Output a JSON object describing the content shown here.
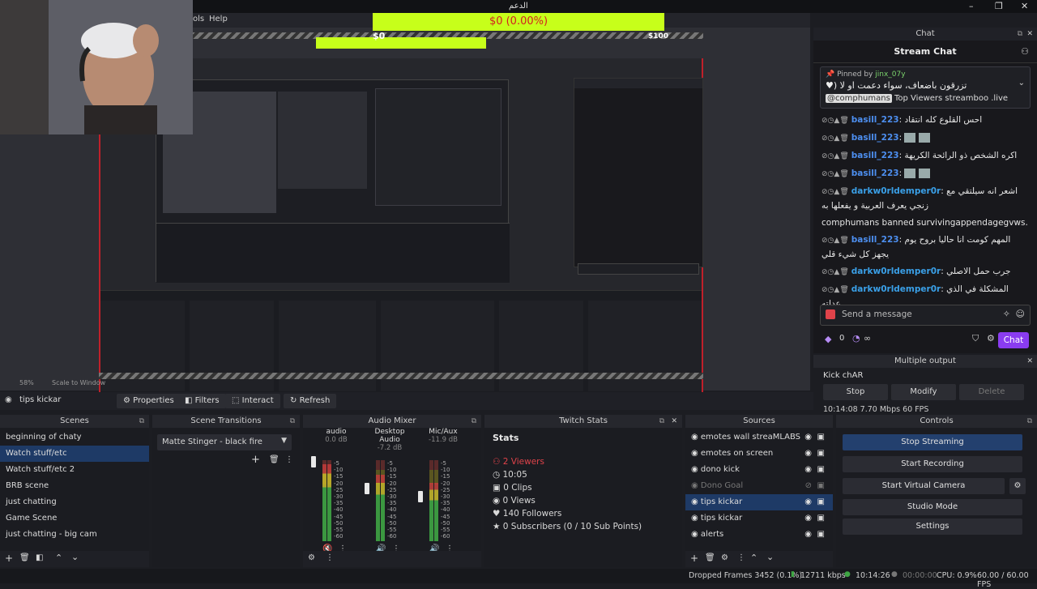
{
  "titlebar": {
    "title": "الدعم"
  },
  "menubar": {
    "items": [
      "ols",
      "Help"
    ]
  },
  "donation": {
    "text": "$0 (0.00%)",
    "inner_text": "$0",
    "inner_right": "$100"
  },
  "preview": {
    "zoom": "58%",
    "scale_label": "Scale to Window"
  },
  "toolbar": {
    "source_name": "tips kickar",
    "properties": "Properties",
    "filters": "Filters",
    "interact": "Interact",
    "refresh": "Refresh"
  },
  "chat": {
    "dock_title": "Chat",
    "header": "Stream Chat",
    "pinned_by": "Pinned by",
    "pinned_user": "jinx_07y",
    "pinned_msg": "تزرقون باضعاف، سواء دعمت او لا (♥",
    "pinned_mention": "@comphumans",
    "pinned_rest": "Top Viewers streamboo .live",
    "messages": [
      {
        "user": "basill_223",
        "text": "احس القلوع كله انتقاد"
      },
      {
        "user": "basill_223",
        "text": ""
      },
      {
        "user": "basill_223",
        "text": "اكره الشخص ذو الرائحة الكريهة"
      },
      {
        "user": "basill_223",
        "text": ""
      },
      {
        "user": "darkw0rldemper0r",
        "text": "اشعر انه سيلتقي مع زنجي يعرف العربية و يفعلها به"
      },
      {
        "user": "",
        "text": "comphumans banned survivingappendagegvws."
      },
      {
        "user": "basill_223",
        "text": "المهم كومت انا حاليا بروح يوم يجهز كل شيء قلي"
      },
      {
        "user": "darkw0rldemper0r",
        "text": "جرب حمل الاصلي"
      },
      {
        "user": "darkw0rldemper0r",
        "text": "المشكلة في الذي عدلته"
      }
    ],
    "input_placeholder": "Send a message",
    "points": "0",
    "chat_button": "Chat"
  },
  "multi_output": {
    "title": "Multiple output",
    "target": "Kick chAR",
    "stop": "Stop",
    "modify": "Modify",
    "delete": "Delete",
    "status": "10:14:08  7.70 Mbps  60 FPS"
  },
  "scenes": {
    "title": "Scenes",
    "items": [
      "beginning of chaty",
      "Watch stuff/etc",
      "Watch stuff/etc 2",
      "BRB scene",
      "just chatting",
      "Game Scene",
      "just chatting - big cam"
    ],
    "selected": 1
  },
  "transitions": {
    "title": "Scene Transitions",
    "selected": "Matte Stinger - black fire"
  },
  "mixer": {
    "title": "Audio Mixer",
    "channels": [
      {
        "name": "audio",
        "db": "0.0 dB",
        "level": 0.95,
        "muted": true
      },
      {
        "name": "Desktop Audio",
        "db": "-7.2 dB",
        "level": 0.82,
        "muted": false
      },
      {
        "name": "Mic/Aux",
        "db": "-11.9 dB",
        "level": 0.72,
        "muted": false
      }
    ],
    "scale": [
      "-5",
      "-10",
      "-15",
      "-20",
      "-25",
      "-30",
      "-35",
      "-40",
      "-45",
      "-50",
      "-55",
      "-60"
    ]
  },
  "stats": {
    "title": "Twitch Stats",
    "heading": "Stats",
    "viewers": "2 Viewers",
    "time": "10:05",
    "clips": "0 Clips",
    "views": "0 Views",
    "followers": "140 Followers",
    "subs": "0 Subscribers (0 / 10 Sub Points)"
  },
  "sources": {
    "title": "Sources",
    "items": [
      "emotes wall streaMLABS",
      "emotes on screen",
      "dono kick",
      "Dono Goal",
      "tips kickar",
      "tips kickar",
      "alerts"
    ],
    "selected": 4,
    "hidden": 3
  },
  "controls": {
    "title": "Controls",
    "stop_streaming": "Stop Streaming",
    "start_recording": "Start Recording",
    "start_virtual_camera": "Start Virtual Camera",
    "studio_mode": "Studio Mode",
    "settings": "Settings"
  },
  "statusbar": {
    "dropped": "Dropped Frames 3452 (0.1%)",
    "bitrate": "12711 kbps",
    "live_time": "10:14:26",
    "rec_time": "00:00:00",
    "cpu": "CPU: 0.9%",
    "fps": "60.00 / 60.00 FPS"
  },
  "colors": {
    "accent_purple": "#8a3cf0",
    "selection_blue": "#1e3a66",
    "donation_green": "#c7ff1a",
    "donation_red": "#d42020",
    "viewers_red": "#e0434a"
  }
}
